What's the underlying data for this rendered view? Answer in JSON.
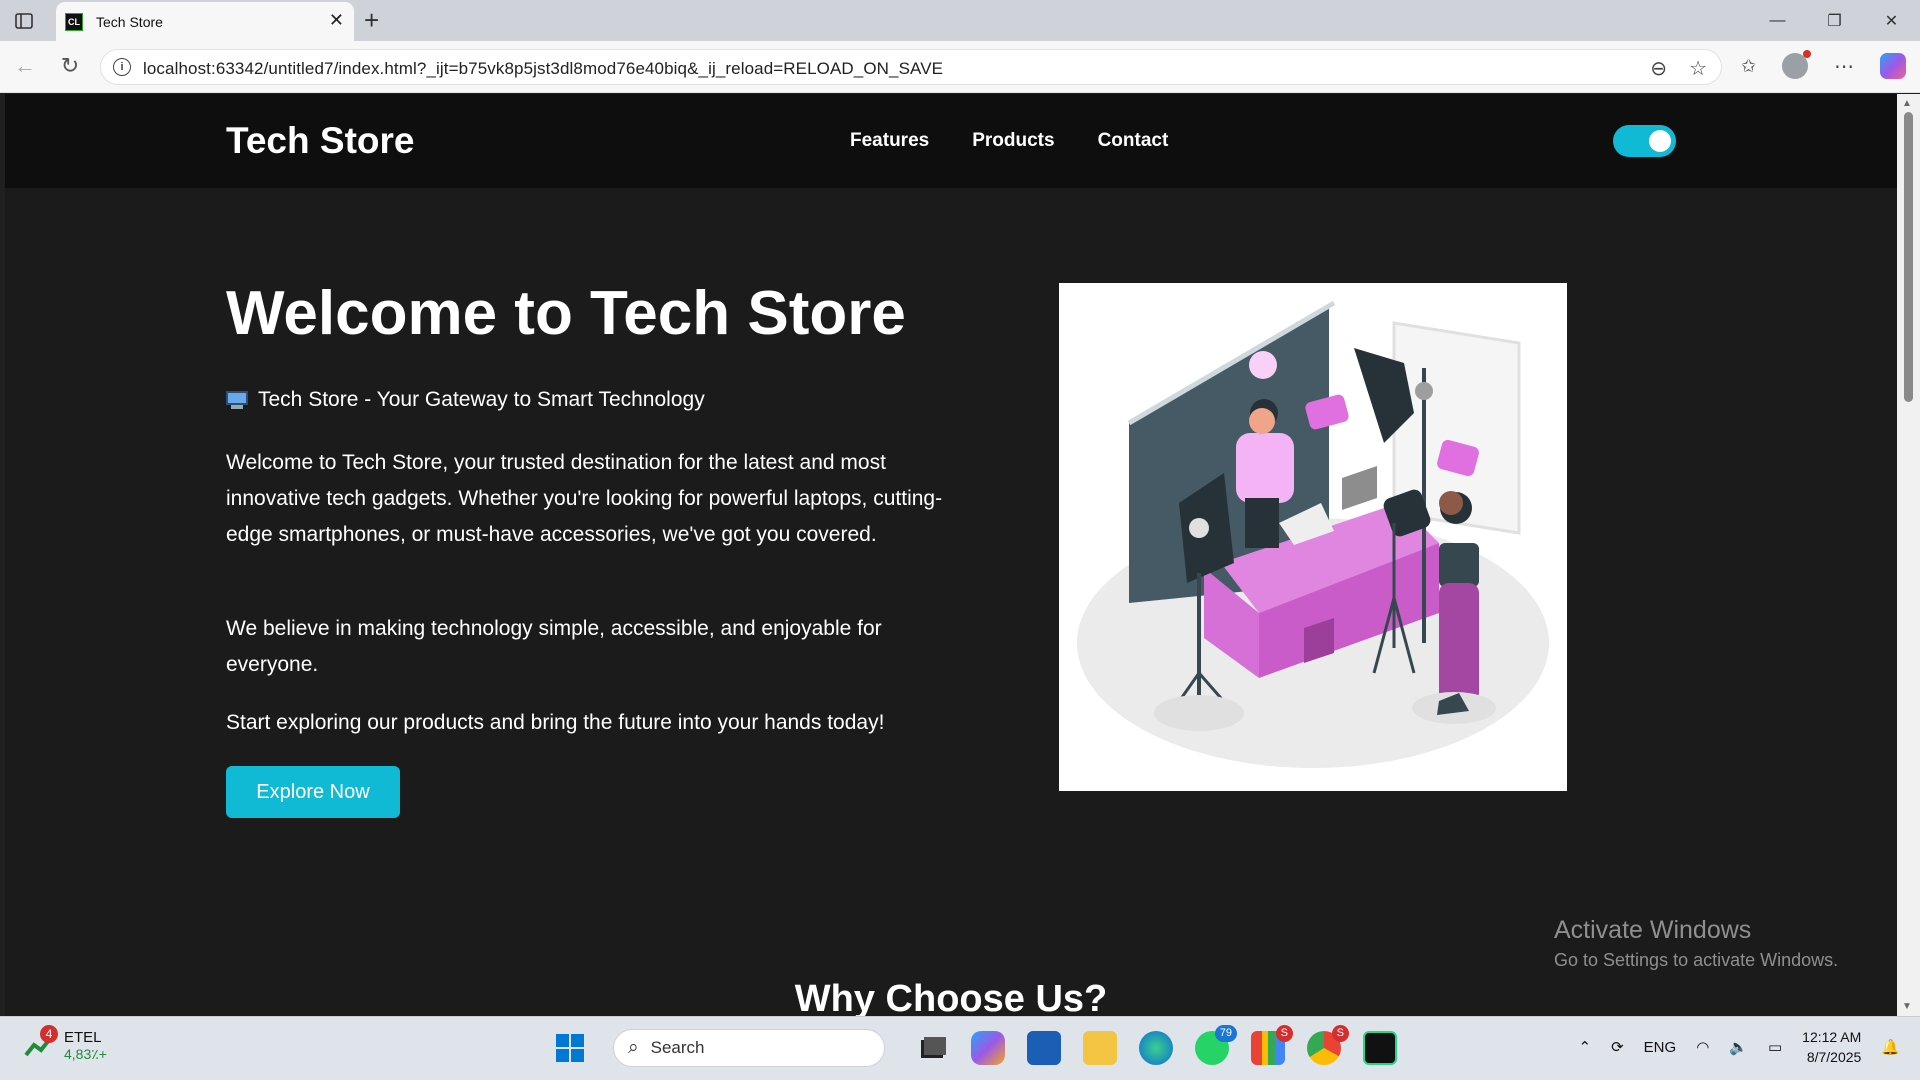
{
  "browser": {
    "tab_title": "Tech Store",
    "tab_favicon": "CL",
    "url": "localhost:63342/untitled7/index.html?_ijt=b75vk8p5jst3dl8mod76e40biq&_ij_reload=RELOAD_ON_SAVE"
  },
  "site": {
    "brand": "Tech Store",
    "nav": [
      "Features",
      "Products",
      "Contact"
    ],
    "theme_toggle_on": true,
    "accent_color": "#10b9d4"
  },
  "hero": {
    "title": "Welcome to Tech Store",
    "tagline": "Tech Store - Your Gateway to Smart Technology",
    "paragraph1": "Welcome to Tech Store, your trusted destination for the latest and most innovative tech gadgets. Whether you're looking for powerful laptops, cutting-edge smartphones, or must-have accessories, we've got you covered.",
    "paragraph2": "We believe in making technology simple, accessible, and enjoyable for everyone.",
    "paragraph3": "Start exploring our products and bring the future into your hands today!",
    "button": "Explore Now"
  },
  "next_section_title": "Why Choose Us?",
  "watermark": {
    "line1": "Activate Windows",
    "line2": "Go to Settings to activate Windows."
  },
  "taskbar": {
    "stock_badge": "4",
    "stock_name": "ETEL",
    "stock_value": "4,83٪+",
    "search_placeholder": "Search",
    "whatsapp_badge": "79",
    "gmail_badge": "S",
    "chrome_badge": "S",
    "language": "ENG",
    "time": "12:12 AM",
    "date": "8/7/2025"
  }
}
